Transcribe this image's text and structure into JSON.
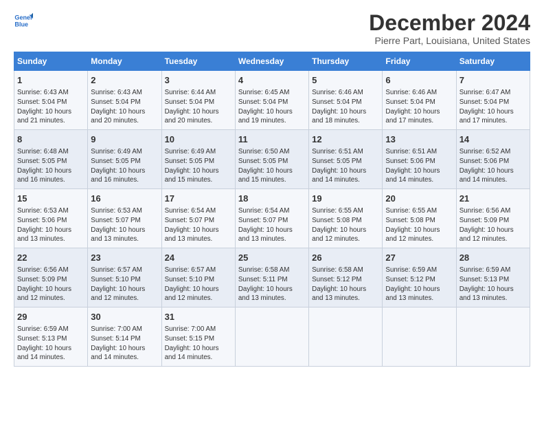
{
  "logo": {
    "line1": "General",
    "line2": "Blue"
  },
  "title": "December 2024",
  "subtitle": "Pierre Part, Louisiana, United States",
  "days_of_week": [
    "Sunday",
    "Monday",
    "Tuesday",
    "Wednesday",
    "Thursday",
    "Friday",
    "Saturday"
  ],
  "weeks": [
    [
      {
        "day": "1",
        "text": "Sunrise: 6:43 AM\nSunset: 5:04 PM\nDaylight: 10 hours\nand 21 minutes."
      },
      {
        "day": "2",
        "text": "Sunrise: 6:43 AM\nSunset: 5:04 PM\nDaylight: 10 hours\nand 20 minutes."
      },
      {
        "day": "3",
        "text": "Sunrise: 6:44 AM\nSunset: 5:04 PM\nDaylight: 10 hours\nand 20 minutes."
      },
      {
        "day": "4",
        "text": "Sunrise: 6:45 AM\nSunset: 5:04 PM\nDaylight: 10 hours\nand 19 minutes."
      },
      {
        "day": "5",
        "text": "Sunrise: 6:46 AM\nSunset: 5:04 PM\nDaylight: 10 hours\nand 18 minutes."
      },
      {
        "day": "6",
        "text": "Sunrise: 6:46 AM\nSunset: 5:04 PM\nDaylight: 10 hours\nand 17 minutes."
      },
      {
        "day": "7",
        "text": "Sunrise: 6:47 AM\nSunset: 5:04 PM\nDaylight: 10 hours\nand 17 minutes."
      }
    ],
    [
      {
        "day": "8",
        "text": "Sunrise: 6:48 AM\nSunset: 5:05 PM\nDaylight: 10 hours\nand 16 minutes."
      },
      {
        "day": "9",
        "text": "Sunrise: 6:49 AM\nSunset: 5:05 PM\nDaylight: 10 hours\nand 16 minutes."
      },
      {
        "day": "10",
        "text": "Sunrise: 6:49 AM\nSunset: 5:05 PM\nDaylight: 10 hours\nand 15 minutes."
      },
      {
        "day": "11",
        "text": "Sunrise: 6:50 AM\nSunset: 5:05 PM\nDaylight: 10 hours\nand 15 minutes."
      },
      {
        "day": "12",
        "text": "Sunrise: 6:51 AM\nSunset: 5:05 PM\nDaylight: 10 hours\nand 14 minutes."
      },
      {
        "day": "13",
        "text": "Sunrise: 6:51 AM\nSunset: 5:06 PM\nDaylight: 10 hours\nand 14 minutes."
      },
      {
        "day": "14",
        "text": "Sunrise: 6:52 AM\nSunset: 5:06 PM\nDaylight: 10 hours\nand 14 minutes."
      }
    ],
    [
      {
        "day": "15",
        "text": "Sunrise: 6:53 AM\nSunset: 5:06 PM\nDaylight: 10 hours\nand 13 minutes."
      },
      {
        "day": "16",
        "text": "Sunrise: 6:53 AM\nSunset: 5:07 PM\nDaylight: 10 hours\nand 13 minutes."
      },
      {
        "day": "17",
        "text": "Sunrise: 6:54 AM\nSunset: 5:07 PM\nDaylight: 10 hours\nand 13 minutes."
      },
      {
        "day": "18",
        "text": "Sunrise: 6:54 AM\nSunset: 5:07 PM\nDaylight: 10 hours\nand 13 minutes."
      },
      {
        "day": "19",
        "text": "Sunrise: 6:55 AM\nSunset: 5:08 PM\nDaylight: 10 hours\nand 12 minutes."
      },
      {
        "day": "20",
        "text": "Sunrise: 6:55 AM\nSunset: 5:08 PM\nDaylight: 10 hours\nand 12 minutes."
      },
      {
        "day": "21",
        "text": "Sunrise: 6:56 AM\nSunset: 5:09 PM\nDaylight: 10 hours\nand 12 minutes."
      }
    ],
    [
      {
        "day": "22",
        "text": "Sunrise: 6:56 AM\nSunset: 5:09 PM\nDaylight: 10 hours\nand 12 minutes."
      },
      {
        "day": "23",
        "text": "Sunrise: 6:57 AM\nSunset: 5:10 PM\nDaylight: 10 hours\nand 12 minutes."
      },
      {
        "day": "24",
        "text": "Sunrise: 6:57 AM\nSunset: 5:10 PM\nDaylight: 10 hours\nand 12 minutes."
      },
      {
        "day": "25",
        "text": "Sunrise: 6:58 AM\nSunset: 5:11 PM\nDaylight: 10 hours\nand 13 minutes."
      },
      {
        "day": "26",
        "text": "Sunrise: 6:58 AM\nSunset: 5:12 PM\nDaylight: 10 hours\nand 13 minutes."
      },
      {
        "day": "27",
        "text": "Sunrise: 6:59 AM\nSunset: 5:12 PM\nDaylight: 10 hours\nand 13 minutes."
      },
      {
        "day": "28",
        "text": "Sunrise: 6:59 AM\nSunset: 5:13 PM\nDaylight: 10 hours\nand 13 minutes."
      }
    ],
    [
      {
        "day": "29",
        "text": "Sunrise: 6:59 AM\nSunset: 5:13 PM\nDaylight: 10 hours\nand 14 minutes."
      },
      {
        "day": "30",
        "text": "Sunrise: 7:00 AM\nSunset: 5:14 PM\nDaylight: 10 hours\nand 14 minutes."
      },
      {
        "day": "31",
        "text": "Sunrise: 7:00 AM\nSunset: 5:15 PM\nDaylight: 10 hours\nand 14 minutes."
      },
      {
        "day": "",
        "text": ""
      },
      {
        "day": "",
        "text": ""
      },
      {
        "day": "",
        "text": ""
      },
      {
        "day": "",
        "text": ""
      }
    ]
  ]
}
